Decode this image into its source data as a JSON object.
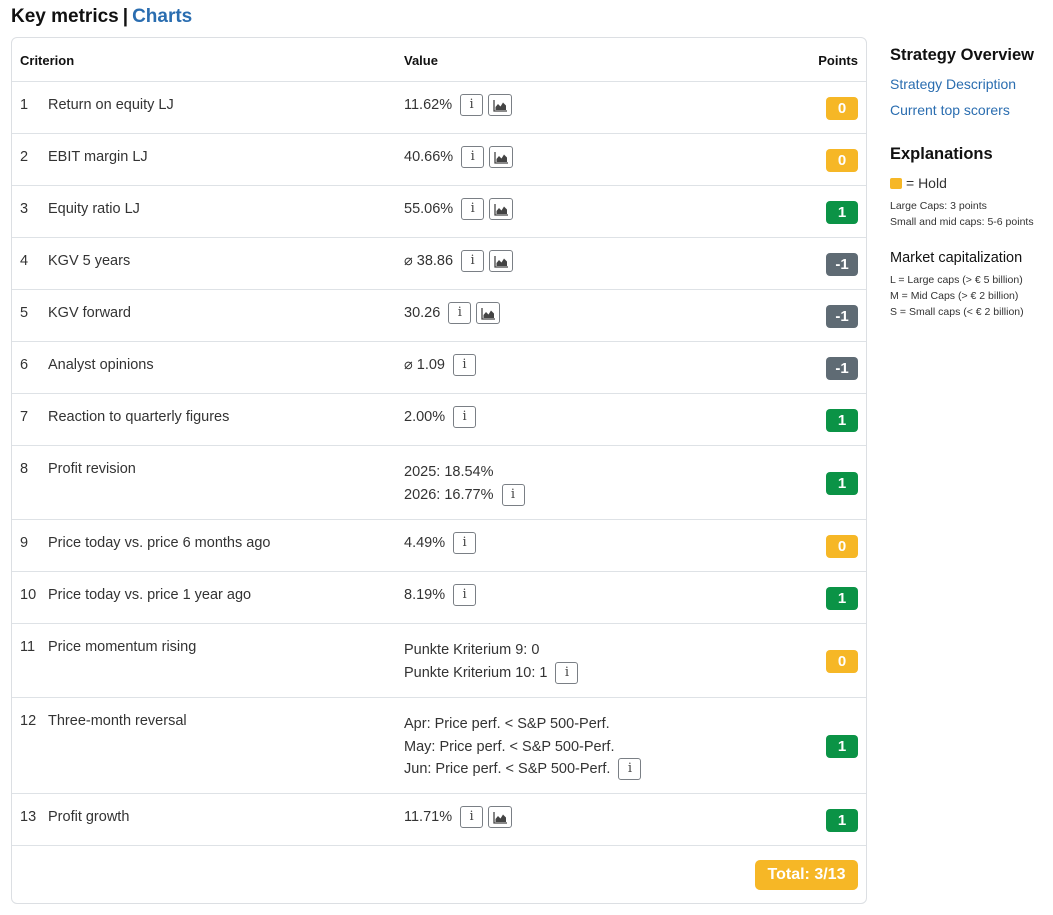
{
  "header": {
    "title": "Key metrics",
    "separator": "|",
    "charts_link": "Charts"
  },
  "table": {
    "columns": {
      "criterion": "Criterion",
      "value": "Value",
      "points": "Points"
    },
    "rows": [
      {
        "num": "1",
        "criterion": "Return on equity LJ",
        "value_lines": [
          "11.62%"
        ],
        "info": true,
        "chart": true,
        "points": "0",
        "color": "yellow"
      },
      {
        "num": "2",
        "criterion": "EBIT margin LJ",
        "value_lines": [
          "40.66%"
        ],
        "info": true,
        "chart": true,
        "points": "0",
        "color": "yellow"
      },
      {
        "num": "3",
        "criterion": "Equity ratio LJ",
        "value_lines": [
          "55.06%"
        ],
        "info": true,
        "chart": true,
        "points": "1",
        "color": "green"
      },
      {
        "num": "4",
        "criterion": "KGV 5 years",
        "value_lines": [
          "⌀ 38.86"
        ],
        "info": true,
        "chart": true,
        "points": "-1",
        "color": "gray"
      },
      {
        "num": "5",
        "criterion": "KGV forward",
        "value_lines": [
          "30.26"
        ],
        "info": true,
        "chart": true,
        "points": "-1",
        "color": "gray"
      },
      {
        "num": "6",
        "criterion": "Analyst opinions",
        "value_lines": [
          "⌀ 1.09"
        ],
        "info": true,
        "chart": false,
        "points": "-1",
        "color": "gray"
      },
      {
        "num": "7",
        "criterion": "Reaction to quarterly figures",
        "value_lines": [
          "2.00%"
        ],
        "info": true,
        "chart": false,
        "points": "1",
        "color": "green"
      },
      {
        "num": "8",
        "criterion": "Profit revision",
        "value_lines": [
          "2025: 18.54%",
          "2026: 16.77%"
        ],
        "info": true,
        "chart": false,
        "points": "1",
        "color": "green"
      },
      {
        "num": "9",
        "criterion": "Price today vs. price 6 months ago",
        "value_lines": [
          "4.49%"
        ],
        "info": true,
        "chart": false,
        "points": "0",
        "color": "yellow"
      },
      {
        "num": "10",
        "criterion": "Price today vs. price 1 year ago",
        "value_lines": [
          "8.19%"
        ],
        "info": true,
        "chart": false,
        "points": "1",
        "color": "green"
      },
      {
        "num": "11",
        "criterion": "Price momentum rising",
        "value_lines": [
          "Punkte Kriterium 9: 0",
          "Punkte Kriterium 10: 1"
        ],
        "info": true,
        "chart": false,
        "points": "0",
        "color": "yellow"
      },
      {
        "num": "12",
        "criterion": "Three-month reversal",
        "value_lines": [
          "Apr: Price perf. < S&P 500-Perf.",
          "May: Price perf. < S&P 500-Perf.",
          "Jun: Price perf. < S&P 500-Perf."
        ],
        "info": true,
        "chart": false,
        "points": "1",
        "color": "green"
      },
      {
        "num": "13",
        "criterion": "Profit growth",
        "value_lines": [
          "11.71%"
        ],
        "info": true,
        "chart": true,
        "points": "1",
        "color": "green"
      }
    ],
    "total": "Total: 3/13"
  },
  "sidebar": {
    "strategy_title": "Strategy Overview",
    "strategy_description_link": "Strategy Description",
    "top_scorers_link": "Current top scorers",
    "explanations_title": "Explanations",
    "hold_label": "= Hold",
    "large_caps_note": "Large Caps: 3 points",
    "small_mid_caps_note": "Small and mid caps: 5-6 points",
    "market_cap_title": "Market capitalization",
    "market_cap_items": [
      "L = Large caps (> € 5 billion)",
      "M = Mid Caps (> € 2 billion)",
      "S = Small caps (< € 2 billion)"
    ]
  },
  "colors": {
    "yellow": "#f6b726",
    "green": "#0b9346",
    "gray": "#5f6b74",
    "link": "#2a6db0"
  },
  "icons": {
    "info": "info-icon",
    "chart": "area-chart-icon"
  }
}
